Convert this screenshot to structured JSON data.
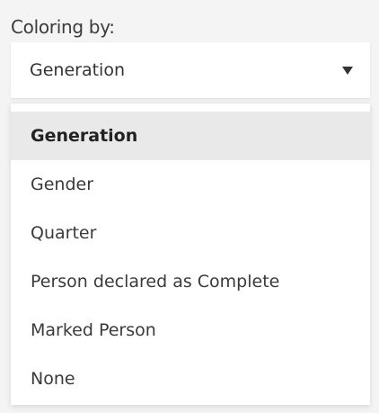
{
  "coloring": {
    "label": "Coloring by:",
    "selected_value": "Generation",
    "options": [
      {
        "label": "Generation",
        "selected": true
      },
      {
        "label": "Gender",
        "selected": false
      },
      {
        "label": "Quarter",
        "selected": false
      },
      {
        "label": "Person declared as Complete",
        "selected": false
      },
      {
        "label": "Marked Person",
        "selected": false
      },
      {
        "label": "None",
        "selected": false
      }
    ]
  },
  "icons": {
    "dropdown": "chevron-down-icon"
  }
}
